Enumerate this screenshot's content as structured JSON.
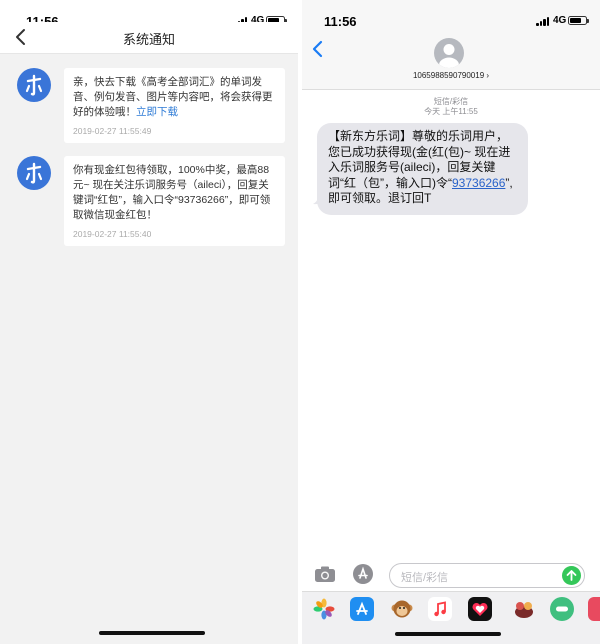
{
  "left_screen": {
    "status_time": "11:56",
    "network": "4G",
    "battery_percent": 70,
    "nav_title": "系统通知",
    "notifications": [
      {
        "text": "亲，快去下载《高考全部词汇》的单词发音、例句发音、图片等内容吧，将会获得更好的体验哦！",
        "link_text": "立即下载",
        "time": "2019-02-27 11:55:49"
      },
      {
        "text": "你有现金红包待领取，100%中奖，最高88元~ 现在关注乐词服务号（aileci），回复关键词“红包”，输入口令“93736266”，即可领取微信现金红包！",
        "link_text": "",
        "time": "2019-02-27 11:55:40"
      }
    ]
  },
  "right_screen": {
    "status_time": "11:56",
    "network": "4G",
    "battery_percent": 70,
    "contact_number": "1065988590790019 ›",
    "message_type_label": "短信/彩信",
    "message_date_label": "今天 上午11:55",
    "sms_before_code": "【新东方乐词】尊敬的乐词用户，您已成功获得现(金(红(包)~ 现在进入乐词服务号(aileci)，回复关键词“红（包”，输入口)令“",
    "sms_code": "93736266",
    "sms_after_code": "”,即可领取。退订回T",
    "input_placeholder": "短信/彩信",
    "drawer_apps": [
      {
        "icon": "photos-app-icon",
        "color": "#ffffff"
      },
      {
        "icon": "app-store-icon",
        "color": "#1f8ef1"
      },
      {
        "icon": "monkey-memoji-icon",
        "color": "#f0f0f2"
      },
      {
        "icon": "music-app-icon",
        "color": "#ffffff"
      },
      {
        "icon": "digital-touch-icon",
        "color": "#111111"
      },
      {
        "icon": "sticker-app-icon",
        "color": "#f0f0f2"
      },
      {
        "icon": "meituan-app-icon",
        "color": "#3fbf7f"
      },
      {
        "icon": "partial-app-icon",
        "color": "#e84a5f"
      }
    ]
  }
}
